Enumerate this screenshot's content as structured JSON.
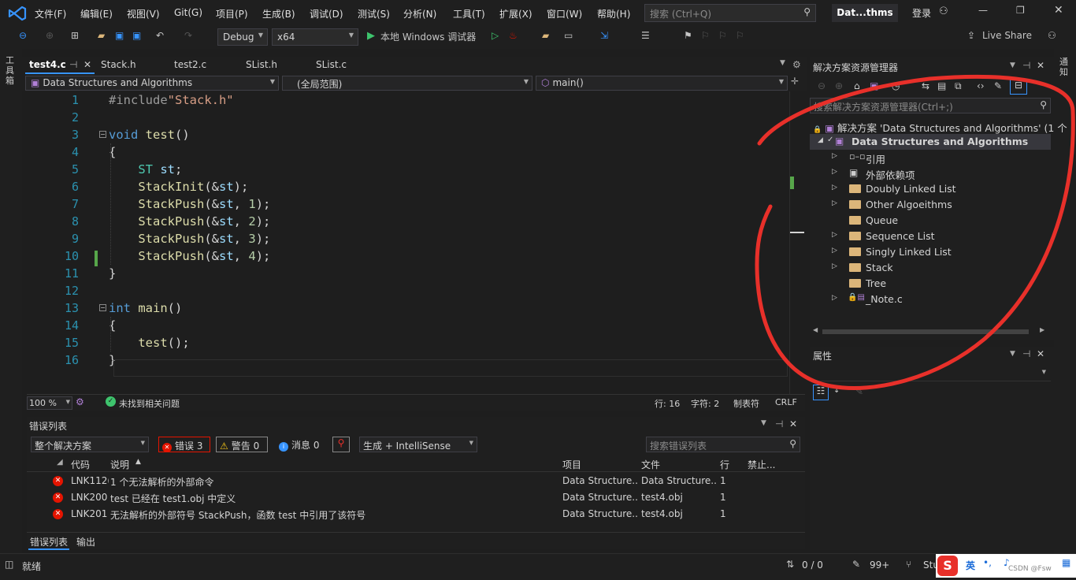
{
  "menu": [
    "文件(F)",
    "编辑(E)",
    "视图(V)",
    "Git(G)",
    "项目(P)",
    "生成(B)",
    "调试(D)",
    "测试(S)",
    "分析(N)",
    "工具(T)",
    "扩展(X)",
    "窗口(W)",
    "帮助(H)"
  ],
  "search": {
    "placeholder": "搜索 (Ctrl+Q)"
  },
  "title_badge": "Dat...thms",
  "login": "登录",
  "live_share": "Live Share",
  "toolbar": {
    "config": "Debug",
    "platform": "x64",
    "run_label": "本地 Windows 调试器"
  },
  "left_strip": "工具箱",
  "right_strip": "通知",
  "tabs": [
    {
      "label": "test4.c",
      "active": true
    },
    {
      "label": "Stack.h"
    },
    {
      "label": "test2.c"
    },
    {
      "label": "SList.h"
    },
    {
      "label": "SList.c"
    }
  ],
  "nav": {
    "project": "Data Structures and Algorithms",
    "scope": "(全局范围)",
    "member": "main()"
  },
  "code_lines": [
    {
      "n": "1",
      "parts": [
        {
          "c": "pre",
          "t": "#include"
        },
        {
          "c": "st",
          "t": "\"Stack.h\""
        }
      ]
    },
    {
      "n": "2",
      "parts": []
    },
    {
      "n": "3",
      "parts": [
        {
          "c": "kw",
          "t": "void "
        },
        {
          "c": "fn",
          "t": "test"
        },
        {
          "c": "pl",
          "t": "()"
        }
      ]
    },
    {
      "n": "4",
      "parts": [
        {
          "c": "pl",
          "t": "{"
        }
      ]
    },
    {
      "n": "5",
      "parts": [
        {
          "c": "pl",
          "t": "    "
        },
        {
          "c": "ty",
          "t": "ST "
        },
        {
          "c": "va",
          "t": "st"
        },
        {
          "c": "pl",
          "t": ";"
        }
      ]
    },
    {
      "n": "6",
      "parts": [
        {
          "c": "pl",
          "t": "    "
        },
        {
          "c": "fn",
          "t": "StackInit"
        },
        {
          "c": "pl",
          "t": "(&"
        },
        {
          "c": "va",
          "t": "st"
        },
        {
          "c": "pl",
          "t": ");"
        }
      ]
    },
    {
      "n": "7",
      "parts": [
        {
          "c": "pl",
          "t": "    "
        },
        {
          "c": "fn",
          "t": "StackPush"
        },
        {
          "c": "pl",
          "t": "(&"
        },
        {
          "c": "va",
          "t": "st"
        },
        {
          "c": "pl",
          "t": ", "
        },
        {
          "c": "nu",
          "t": "1"
        },
        {
          "c": "pl",
          "t": ");"
        }
      ]
    },
    {
      "n": "8",
      "parts": [
        {
          "c": "pl",
          "t": "    "
        },
        {
          "c": "fn",
          "t": "StackPush"
        },
        {
          "c": "pl",
          "t": "(&"
        },
        {
          "c": "va",
          "t": "st"
        },
        {
          "c": "pl",
          "t": ", "
        },
        {
          "c": "nu",
          "t": "2"
        },
        {
          "c": "pl",
          "t": ");"
        }
      ]
    },
    {
      "n": "9",
      "parts": [
        {
          "c": "pl",
          "t": "    "
        },
        {
          "c": "fn",
          "t": "StackPush"
        },
        {
          "c": "pl",
          "t": "(&"
        },
        {
          "c": "va",
          "t": "st"
        },
        {
          "c": "pl",
          "t": ", "
        },
        {
          "c": "nu",
          "t": "3"
        },
        {
          "c": "pl",
          "t": ");"
        }
      ]
    },
    {
      "n": "10",
      "parts": [
        {
          "c": "pl",
          "t": "    "
        },
        {
          "c": "fn",
          "t": "StackPush"
        },
        {
          "c": "pl",
          "t": "(&"
        },
        {
          "c": "va",
          "t": "st"
        },
        {
          "c": "pl",
          "t": ", "
        },
        {
          "c": "nu",
          "t": "4"
        },
        {
          "c": "pl",
          "t": ");"
        }
      ]
    },
    {
      "n": "11",
      "parts": [
        {
          "c": "pl",
          "t": "}"
        }
      ]
    },
    {
      "n": "12",
      "parts": []
    },
    {
      "n": "13",
      "parts": [
        {
          "c": "kw",
          "t": "int "
        },
        {
          "c": "fn",
          "t": "main"
        },
        {
          "c": "pl",
          "t": "()"
        }
      ]
    },
    {
      "n": "14",
      "parts": [
        {
          "c": "pl",
          "t": "{"
        }
      ]
    },
    {
      "n": "15",
      "parts": [
        {
          "c": "pl",
          "t": "    "
        },
        {
          "c": "fn",
          "t": "test"
        },
        {
          "c": "pl",
          "t": "();"
        }
      ]
    },
    {
      "n": "16",
      "parts": [
        {
          "c": "pl",
          "t": "}"
        }
      ]
    }
  ],
  "editor_status": {
    "zoom": "100 %",
    "issues": "未找到相关问题",
    "row": "行: 16",
    "col": "字符: 2",
    "tabs": "制表符",
    "eol": "CRLF"
  },
  "error_list": {
    "title": "错误列表",
    "scope": "整个解决方案",
    "errors": "错误 3",
    "warnings": "警告 0",
    "messages": "消息 0",
    "source": "生成 + IntelliSense",
    "search_placeholder": "搜索错误列表",
    "headers": [
      "代码",
      "说明",
      "项目",
      "文件",
      "行",
      "禁止..."
    ],
    "rows": [
      {
        "code": "LNK112(",
        "desc": "1 个无法解析的外部命令",
        "project": "Data Structure...",
        "file": "Data Structure...",
        "line": "1"
      },
      {
        "code": "LNK200!",
        "desc": "test 已经在 test1.obj 中定义",
        "project": "Data Structure...",
        "file": "test4.obj",
        "line": "1"
      },
      {
        "code": "LNK201!",
        "desc": "无法解析的外部符号 StackPush，函数 test 中引用了该符号",
        "project": "Data Structure...",
        "file": "test4.obj",
        "line": "1"
      }
    ],
    "bottom_tabs": [
      "错误列表",
      "输出"
    ]
  },
  "solution_explorer": {
    "title": "解决方案资源管理器",
    "search_placeholder": "搜索解决方案资源管理器(Ctrl+;)",
    "solution": "解决方案 'Data Structures and Algorithms' (1 个",
    "project": "Data Structures and Algorithms",
    "items": [
      {
        "label": "引用",
        "icon": "references-icon",
        "expand": true
      },
      {
        "label": "外部依赖项",
        "icon": "external-deps-icon",
        "expand": true
      },
      {
        "label": "Doubly Linked List",
        "icon": "folder-icon",
        "expand": true
      },
      {
        "label": "Other Algoeithms",
        "icon": "folder-icon",
        "expand": true
      },
      {
        "label": "Queue",
        "icon": "folder-icon",
        "expand": false
      },
      {
        "label": "Sequence List",
        "icon": "folder-icon",
        "expand": true
      },
      {
        "label": "Singly Linked List",
        "icon": "folder-icon",
        "expand": true
      },
      {
        "label": "Stack",
        "icon": "folder-icon",
        "expand": true
      },
      {
        "label": "Tree",
        "icon": "folder-icon",
        "expand": false
      },
      {
        "label": "_Note.c",
        "icon": "c-file-icon",
        "expand": true
      }
    ]
  },
  "properties": {
    "title": "属性"
  },
  "statusbar": {
    "ready": "就绪",
    "sync": "0 / 0",
    "edits": "99+",
    "branch": "Stu",
    "ime": "英",
    "watermark": "CSDN @Fsw"
  },
  "colors": {
    "accent": "#3794ff",
    "error": "#e51400",
    "annotation": "#e8302a",
    "bg": "#1e1e1e"
  }
}
